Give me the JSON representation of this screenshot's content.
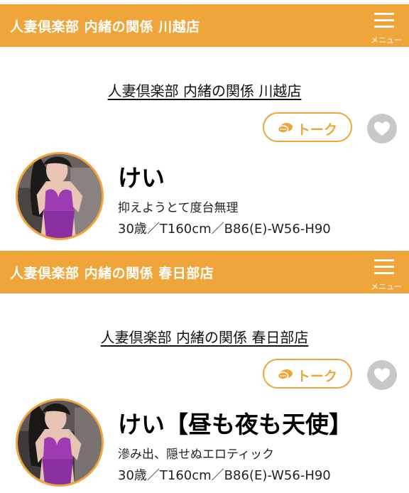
{
  "menu_label": "メニュー",
  "talk_label": "トーク",
  "cards": [
    {
      "header_title": "人妻倶楽部 内緒の関係 川越店",
      "shop_name": "人妻倶楽部 内緒の関係 川越店",
      "name": "けい",
      "catch": "抑えようとて度台無理",
      "profile": "30歳／T160cm／B86(E)-W56-H90"
    },
    {
      "header_title": "人妻倶楽部 内緒の関係 春日部店",
      "shop_name": "人妻倶楽部 内緒の関係 春日部店",
      "name": "けい【昼も夜も天使】",
      "catch": "滲み出、隠せぬエロティック",
      "profile": "30歳／T160cm／B86(E)-W56-H90"
    }
  ],
  "colors": {
    "accent": "#f0a53a",
    "fav_gray": "#c8c8c8",
    "lingerie": "#9c3cb0"
  },
  "icons": {
    "menu": "hamburger-menu-icon",
    "talk": "chat-bubbles-icon",
    "favorite": "heart-icon"
  }
}
